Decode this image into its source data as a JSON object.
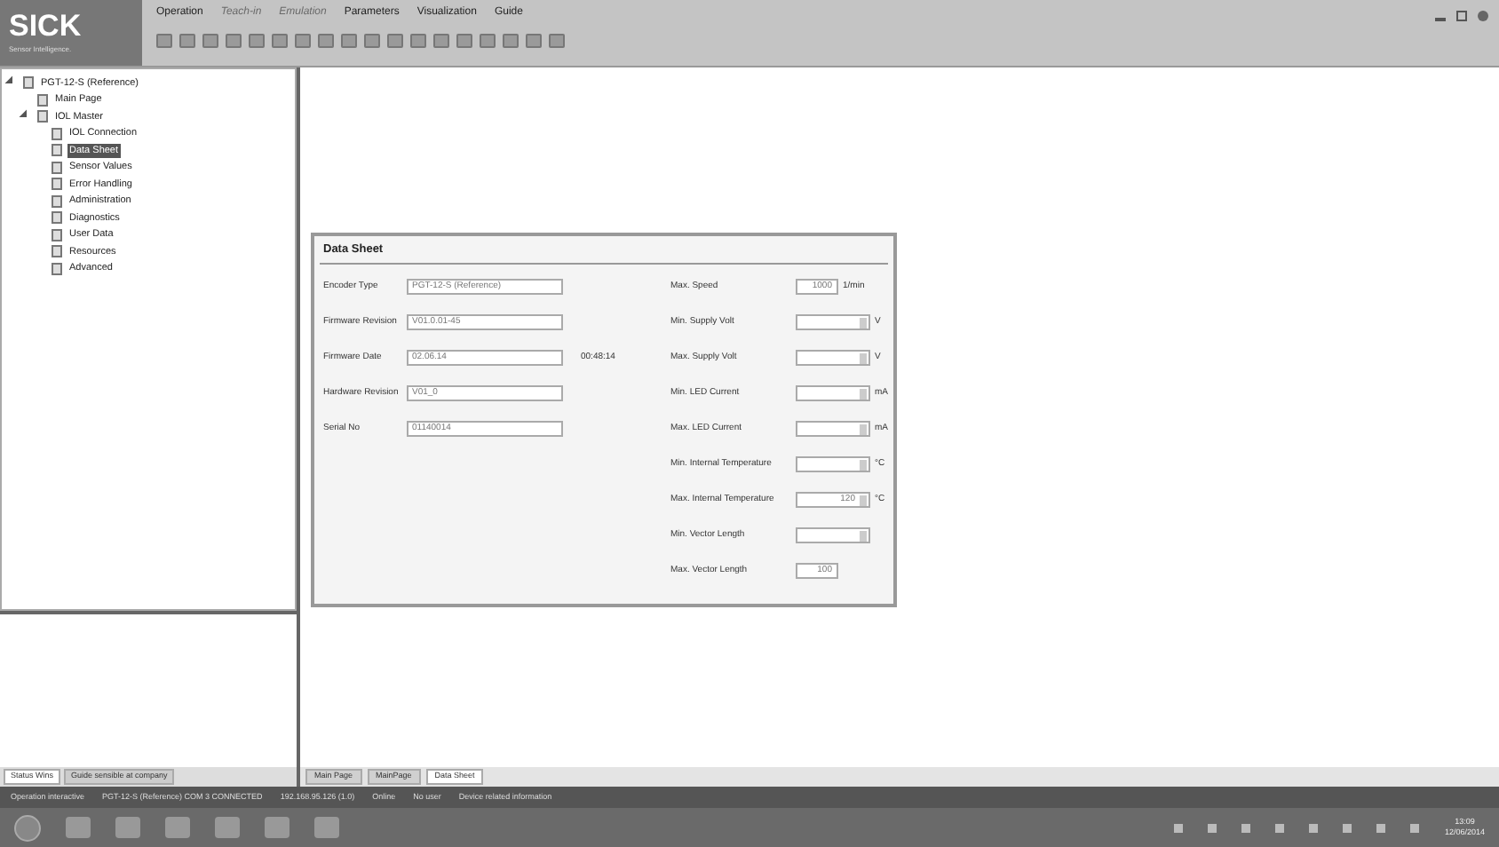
{
  "logo": {
    "name": "SICK",
    "tagline": "Sensor Intelligence."
  },
  "menu": [
    {
      "label": "Operation",
      "disabled": false
    },
    {
      "label": "Teach-in",
      "disabled": true
    },
    {
      "label": "Emulation",
      "disabled": true
    },
    {
      "label": "Parameters",
      "disabled": false
    },
    {
      "label": "Visualization",
      "disabled": false
    },
    {
      "label": "Guide",
      "disabled": false
    }
  ],
  "tree": [
    {
      "label": "PGT-12-S (Reference)",
      "selected": false,
      "expanded": true,
      "children": [
        {
          "label": "Main Page",
          "selected": false
        },
        {
          "label": "IOL Master",
          "selected": false,
          "expanded": true,
          "children": [
            {
              "label": "IOL Connection",
              "selected": false
            },
            {
              "label": "Data Sheet",
              "selected": true
            },
            {
              "label": "Sensor Values",
              "selected": false
            },
            {
              "label": "Error Handling",
              "selected": false
            },
            {
              "label": "Administration",
              "selected": false
            },
            {
              "label": "Diagnostics",
              "selected": false
            },
            {
              "label": "User Data",
              "selected": false
            },
            {
              "label": "Resources",
              "selected": false
            },
            {
              "label": "Advanced",
              "selected": false
            }
          ]
        }
      ]
    }
  ],
  "left_tabs": [
    {
      "label": "Status Wins",
      "selected": true
    },
    {
      "label": "Guide sensible at company",
      "selected": false
    }
  ],
  "data_sheet": {
    "title": "Data Sheet",
    "left_fields": [
      {
        "label": "Encoder Type",
        "value": "PGT-12-S (Reference)"
      },
      {
        "label": "Firmware Revision",
        "value": "V01.0.01-45"
      },
      {
        "label": "Firmware Date",
        "value": "02.06.14",
        "note": "00:48:14"
      },
      {
        "label": "Hardware Revision",
        "value": "V01_0"
      },
      {
        "label": "Serial No",
        "value": "01140014"
      }
    ],
    "right_fields": [
      {
        "label": "Max. Speed",
        "value": "1000",
        "unit": "1/min",
        "kind": "field"
      },
      {
        "label": "Min. Supply Volt",
        "unit": "V",
        "kind": "spin"
      },
      {
        "label": "Max. Supply Volt",
        "unit": "V",
        "kind": "spin"
      },
      {
        "label": "Min. LED Current",
        "unit": "mA",
        "kind": "spin"
      },
      {
        "label": "Max. LED Current",
        "unit": "mA",
        "kind": "spin"
      },
      {
        "label": "Min. Internal Temperature",
        "unit": "°C",
        "kind": "spin"
      },
      {
        "label": "Max. Internal Temperature",
        "value": "120",
        "unit": "°C",
        "kind": "spin"
      },
      {
        "label": "Min. Vector Length",
        "kind": "spin"
      },
      {
        "label": "Max. Vector Length",
        "value": "100",
        "kind": "field"
      }
    ]
  },
  "doc_tabs": [
    {
      "label": "Main Page",
      "selected": false
    },
    {
      "label": "MainPage",
      "selected": false
    },
    {
      "label": "Data Sheet",
      "selected": true
    }
  ],
  "status_bar": [
    "Operation interactive",
    "PGT-12-S (Reference) COM 3 CONNECTED",
    "192.168.95.126 (1.0)",
    "Online",
    "No user",
    "Device related information"
  ],
  "clock": {
    "time": "13:09",
    "date": "12/06/2014"
  }
}
